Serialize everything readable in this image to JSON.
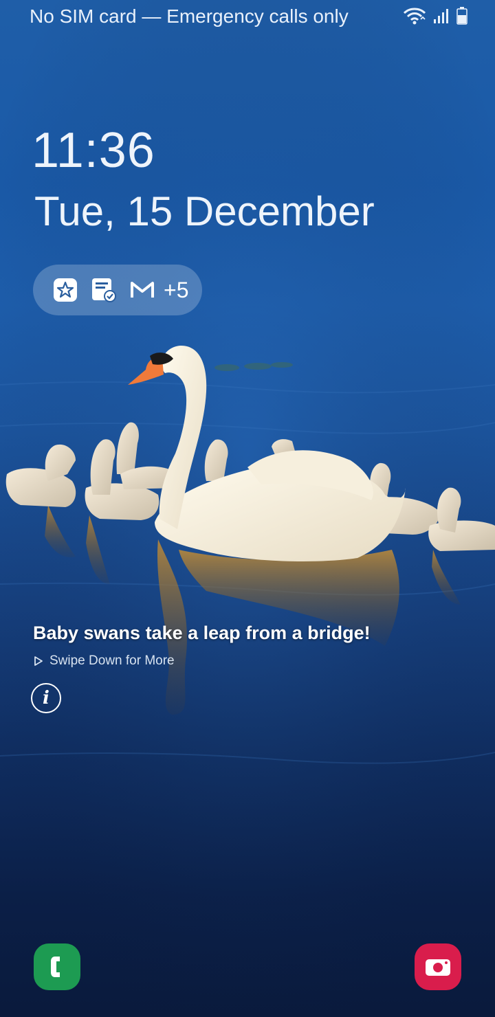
{
  "status_bar": {
    "carrier_text": "No SIM card — Emergency calls only",
    "icons": [
      "wifi-icon",
      "signal-icon",
      "battery-icon"
    ]
  },
  "lockscreen": {
    "time": "11:36",
    "date": "Tue, 15 December"
  },
  "notifications": {
    "icons": [
      "galaxy-store-icon",
      "reminder-icon",
      "gmail-icon"
    ],
    "more_count": "+5"
  },
  "wallpaper_story": {
    "title": "Baby swans take a leap from a bridge!",
    "hint": "Swipe Down for More"
  },
  "shortcuts": {
    "left": "phone-icon",
    "right": "camera-icon"
  },
  "colors": {
    "phone_shortcut": "#1d9b52",
    "camera_shortcut": "#d91d4c"
  }
}
